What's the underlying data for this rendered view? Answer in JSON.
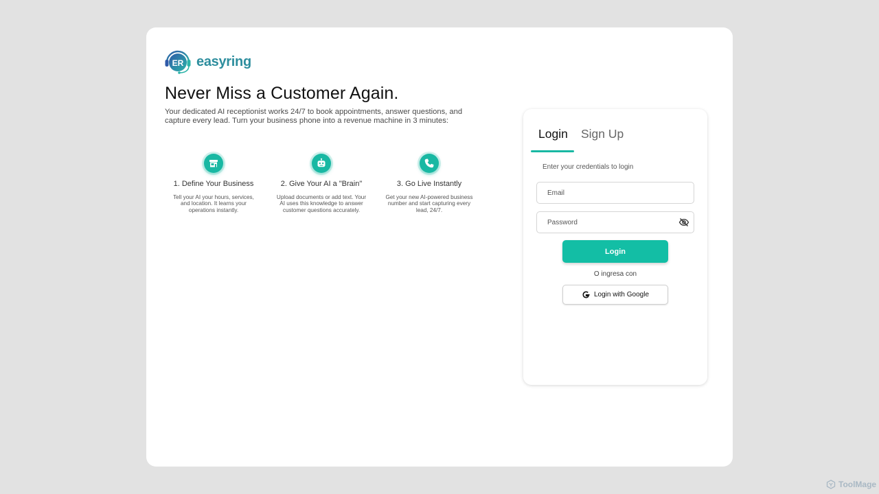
{
  "brand": {
    "name": "easyring",
    "logo_text": "ER",
    "logo_icon": "headset-logo-icon",
    "name_color": "#2e8e9e"
  },
  "hero": {
    "headline": "Never Miss a Customer Again.",
    "subtitle": "Your dedicated AI receptionist works 24/7 to book appointments, answer questions, and capture every lead. Turn your business phone into a revenue machine in 3 minutes:"
  },
  "steps": [
    {
      "icon": "store-icon",
      "title": "1. Define Your Business",
      "description": "Tell your AI your hours, services, and location. It learns your operations instantly."
    },
    {
      "icon": "robot-icon",
      "title": "2. Give Your AI a \"Brain\"",
      "description": "Upload documents or add text. Your AI uses this knowledge to answer customer questions accurately."
    },
    {
      "icon": "phone-icon",
      "title": "3. Go Live Instantly",
      "description": "Get your new AI-powered business number and start capturing every lead, 24/7."
    }
  ],
  "auth": {
    "tabs": [
      {
        "label": "Login",
        "active": true
      },
      {
        "label": "Sign Up",
        "active": false
      }
    ],
    "hint": "Enter your credentials to login",
    "email": {
      "placeholder": "Email",
      "value": ""
    },
    "password": {
      "placeholder": "Password",
      "value": "",
      "toggle_icon": "eye-off-icon"
    },
    "login_button": "Login",
    "or_text": "O ingresa con",
    "google_button": "Login with Google"
  },
  "watermark": {
    "label": "ToolMage",
    "icon": "toolmage-logo-icon"
  },
  "colors": {
    "page_background": "#e2e2e2",
    "card_background": "#ffffff",
    "accent": "#19b8a3",
    "button": "#13bea5",
    "watermark": "#a9b8c4"
  }
}
